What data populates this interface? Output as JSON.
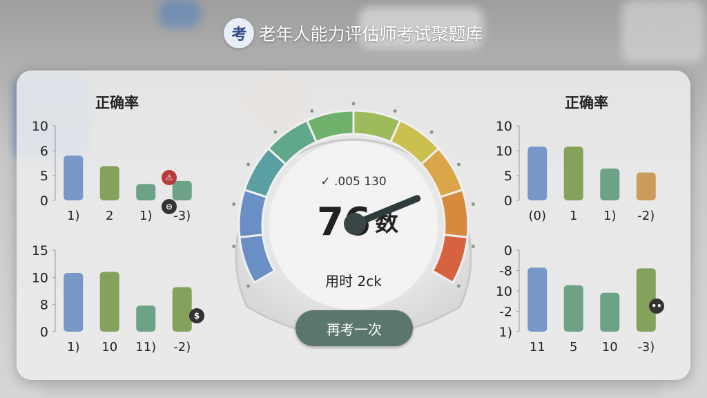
{
  "app": {
    "title": "老年人能力评估师考试聚题库",
    "logo_glyph": "考"
  },
  "left_panel": {
    "heading": "正确率"
  },
  "right_panel": {
    "heading": "正确率"
  },
  "gauge": {
    "check_text": "✓ .005 130",
    "score_text": "76",
    "score_unit": "数",
    "time_text": "用时 2ck",
    "needle_fraction": 0.78
  },
  "retry_button": {
    "label": "再考一次"
  },
  "colors": {
    "blue": "#6a8fc4",
    "olive": "#7a9a4e",
    "teal": "#5f9a7c",
    "orange": "#c9944c",
    "button": "#5b766a"
  },
  "chart_data": [
    {
      "type": "bar",
      "id": "top-left",
      "categories": [
        "1)",
        "2",
        "1)",
        "-3)"
      ],
      "values": [
        6,
        4.6,
        2.2,
        2.6
      ],
      "yticks": [
        "10",
        "6",
        "5",
        "0"
      ],
      "ylim": [
        0,
        10
      ],
      "colors": [
        "#6a8fc4",
        "#7a9a4e",
        "#5f9a7c",
        "#5f9a7c"
      ]
    },
    {
      "type": "bar",
      "id": "bottom-left",
      "categories": [
        "1)",
        "10",
        "11)",
        "-2)"
      ],
      "values": [
        10.8,
        11,
        4.8,
        8.2
      ],
      "yticks": [
        "15",
        "10",
        "8",
        "0"
      ],
      "ylim": [
        0,
        15
      ],
      "colors": [
        "#6a8fc4",
        "#7a9a4e",
        "#5f9a7c",
        "#7a9a4e"
      ]
    },
    {
      "type": "bar",
      "id": "top-right",
      "categories": [
        "(0)",
        "1",
        "1)",
        "-2)"
      ],
      "values": [
        10.8,
        10.8,
        6.4,
        5.6
      ],
      "yticks": [
        "10",
        "10",
        "5",
        "0"
      ],
      "ylim": [
        0,
        15
      ],
      "colors": [
        "#6a8fc4",
        "#7a9a4e",
        "#5f9a7c",
        "#c9944c"
      ]
    },
    {
      "type": "bar",
      "id": "bottom-right",
      "categories": [
        "11",
        "5",
        "10",
        "-3)"
      ],
      "values": [
        10.2,
        7.4,
        6.2,
        10.1
      ],
      "yticks": [
        "0",
        "-8",
        "10",
        "-2",
        "1)"
      ],
      "ylim": [
        0,
        13
      ],
      "colors": [
        "#6a8fc4",
        "#5f9a7c",
        "#5f9a7c",
        "#7a9a4e"
      ]
    }
  ]
}
